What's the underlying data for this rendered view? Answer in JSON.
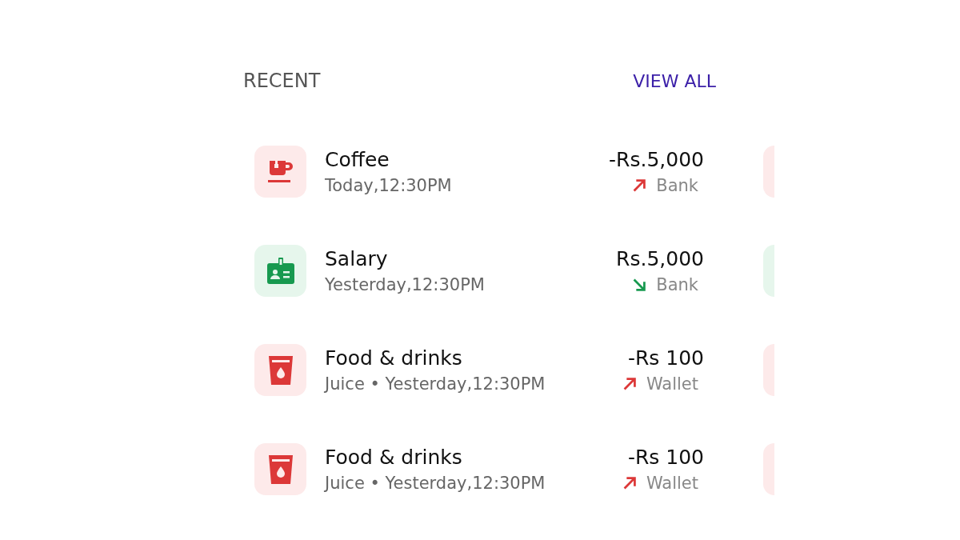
{
  "header": {
    "title": "RECENT",
    "link": "VIEW ALL"
  },
  "transactions": [
    {
      "kind": "coffee",
      "title": "Coffee",
      "subtitle": "Today,12:30PM",
      "amount": "-Rs.5,000",
      "account": "Bank"
    },
    {
      "kind": "salary",
      "title": "Salary",
      "subtitle": "Yesterday,12:30PM",
      "amount": "Rs.5,000",
      "account": "Bank"
    },
    {
      "kind": "food",
      "title": "Food & drinks",
      "subtitle": "Juice • Yesterday,12:30PM",
      "amount": "-Rs 100",
      "account": "Wallet"
    },
    {
      "kind": "food",
      "title": "Food & drinks",
      "subtitle": "Juice • Yesterday,12:30PM",
      "amount": "-Rs 100",
      "account": "Wallet"
    }
  ]
}
